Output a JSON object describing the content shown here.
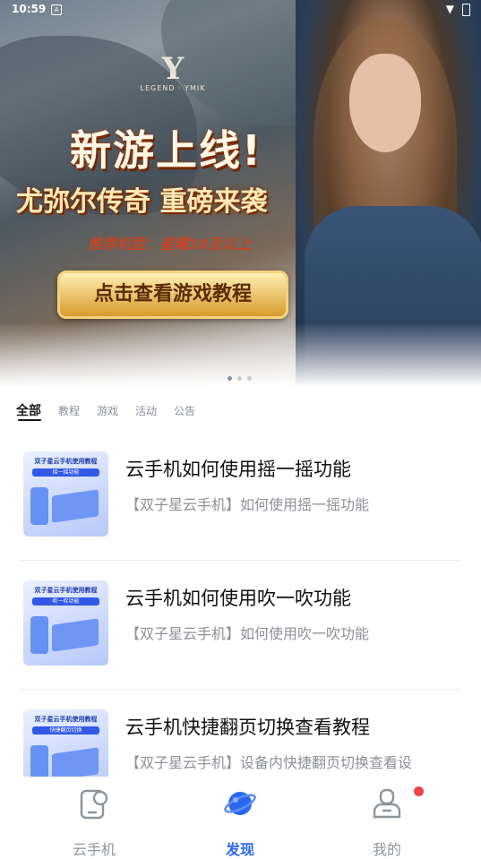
{
  "status_bar": {
    "time": "10:59",
    "notification_icon": "A"
  },
  "banner": {
    "logo_mark": "Y",
    "logo_text": "LEGEND · YMIK",
    "headline": "新游上线!",
    "subhead": "尤弥尔传奇 重磅来袭",
    "recommend": "推荐机型：星曜10及以上",
    "cta": "点击查看游戏教程",
    "page_count": 3,
    "active_index": 0
  },
  "tabs": [
    {
      "label": "全部",
      "active": true
    },
    {
      "label": "教程",
      "active": false
    },
    {
      "label": "游戏",
      "active": false
    },
    {
      "label": "活动",
      "active": false
    },
    {
      "label": "公告",
      "active": false
    }
  ],
  "articles": [
    {
      "thumb_title": "双子星云手机使用教程",
      "thumb_tag": "摇一摇功能",
      "title": "云手机如何使用摇一摇功能",
      "desc": "【双子星云手机】如何使用摇一摇功能"
    },
    {
      "thumb_title": "双子星云手机使用教程",
      "thumb_tag": "吹一吹功能",
      "title": "云手机如何使用吹一吹功能",
      "desc": "【双子星云手机】如何使用吹一吹功能"
    },
    {
      "thumb_title": "双子星云手机使用教程",
      "thumb_tag": "快捷翻页切换",
      "title": "云手机快捷翻页切换查看教程",
      "desc": "【双子星云手机】设备内快捷翻页切换查看设"
    }
  ],
  "bottom_nav": [
    {
      "label": "云手机",
      "icon": "cloud-phone-icon",
      "active": false
    },
    {
      "label": "发现",
      "icon": "planet-icon",
      "active": true
    },
    {
      "label": "我的",
      "icon": "profile-icon",
      "active": false,
      "badge": true
    }
  ],
  "colors": {
    "accent": "#2b68f0",
    "badge": "#f0454a"
  }
}
